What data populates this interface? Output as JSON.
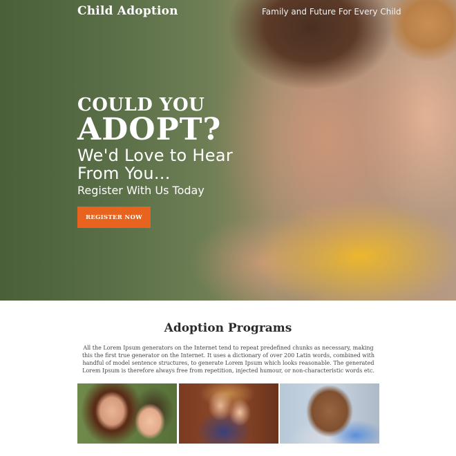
{
  "header": {
    "brand": "Child Adoption",
    "tagline": "Family and Future For Every Child"
  },
  "hero": {
    "line1": "COULD YOU",
    "line2": "ADOPT?",
    "line3": "We'd Love to Hear",
    "line4": "From You...",
    "line5": "Register With Us Today",
    "cta_label": "REGISTER NOW"
  },
  "programs": {
    "title": "Adoption Programs",
    "text": "All the Lorem Ipsum generators on the Internet tend to repeat predefined chunks as necessary, making this the first true generator on the Internet. It uses a dictionary of over 200 Latin words, combined with handful of model sentence structures, to generate Lorem Ipsum which looks reasonable. The generated Lorem Ipsum is therefore always free from repetition, injected humour, or non-characteristic words etc."
  },
  "colors": {
    "accent": "#e8641e",
    "heading": "#2b2b2b",
    "body_text": "#444444"
  }
}
